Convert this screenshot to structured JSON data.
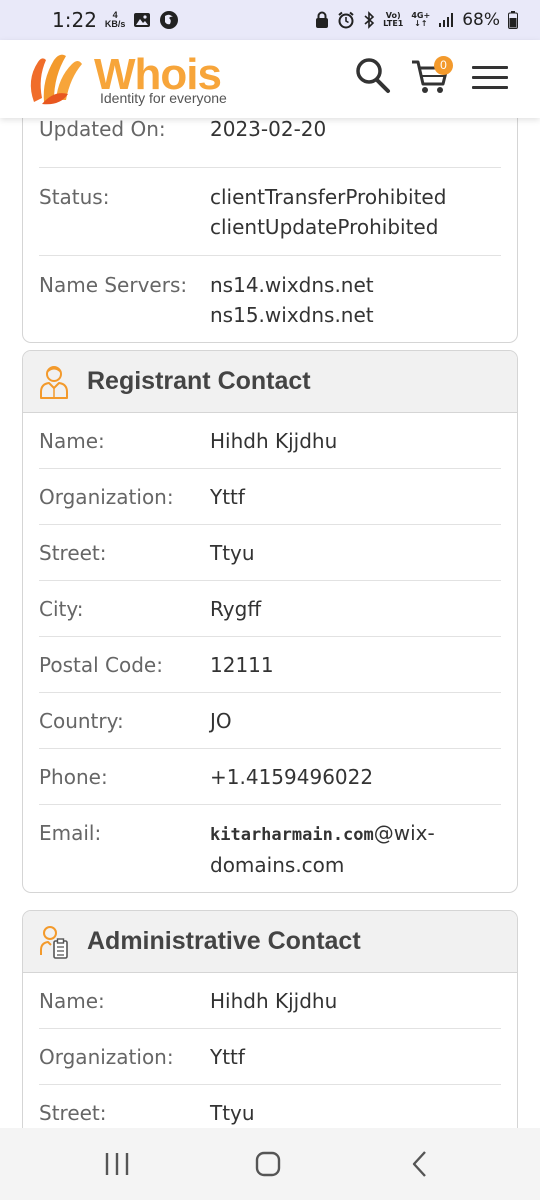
{
  "status_bar": {
    "time": "1:22",
    "speed_value": "4",
    "speed_unit": "KB/s",
    "volte": "Vo)",
    "lte1": "LTE1",
    "net": "4G+",
    "battery": "68%"
  },
  "header": {
    "logo_word": "Whois",
    "logo_tagline": "Identity for everyone",
    "cart_count": "0"
  },
  "domain_card": {
    "rows": [
      {
        "label": "Updated On:",
        "values": [
          "2023-02-20"
        ]
      },
      {
        "label": "Status:",
        "values": [
          "clientTransferProhibited",
          "clientUpdateProhibited"
        ]
      },
      {
        "label": "Name Servers:",
        "values": [
          "ns14.wixdns.net",
          "ns15.wixdns.net"
        ]
      }
    ]
  },
  "registrant": {
    "title": "Registrant Contact",
    "rows": [
      {
        "label": "Name:",
        "value": "Hihdh Kjjdhu"
      },
      {
        "label": "Organization:",
        "value": "Yttf"
      },
      {
        "label": "Street:",
        "value": "Ttyu"
      },
      {
        "label": "City:",
        "value": "Rygff"
      },
      {
        "label": "Postal Code:",
        "value": "12111"
      },
      {
        "label": "Country:",
        "value": "JO"
      },
      {
        "label": "Phone:",
        "value": "+1.4159496022"
      }
    ],
    "email_label": "Email:",
    "email_user": "kitarharmain.com",
    "email_domain_1": "@wix-",
    "email_domain_2": "domains.com"
  },
  "admin": {
    "title": "Administrative Contact",
    "rows": [
      {
        "label": "Name:",
        "value": "Hihdh Kjjdhu"
      },
      {
        "label": "Organization:",
        "value": "Yttf"
      },
      {
        "label": "Street:",
        "value": "Ttyu"
      }
    ]
  },
  "colors": {
    "accent": "#f7a53a",
    "badge": "#f39a2c",
    "status_bar_bg": "#e9e9f9"
  }
}
